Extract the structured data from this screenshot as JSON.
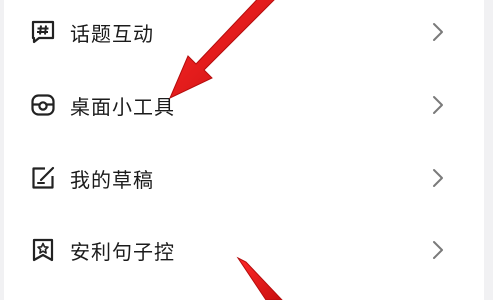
{
  "menu": {
    "items": [
      {
        "label": "话题互动",
        "icon": "hashtag-icon"
      },
      {
        "label": "桌面小工具",
        "icon": "widget-icon"
      },
      {
        "label": "我的草稿",
        "icon": "draft-edit-icon"
      },
      {
        "label": "安利句子控",
        "icon": "star-badge-icon"
      }
    ]
  },
  "colors": {
    "arrow": "#e01616",
    "text": "#1b1b1b",
    "icon": "#222222",
    "chevron": "#7a7a7a",
    "background": "#f1f1f3",
    "card": "#ffffff"
  }
}
